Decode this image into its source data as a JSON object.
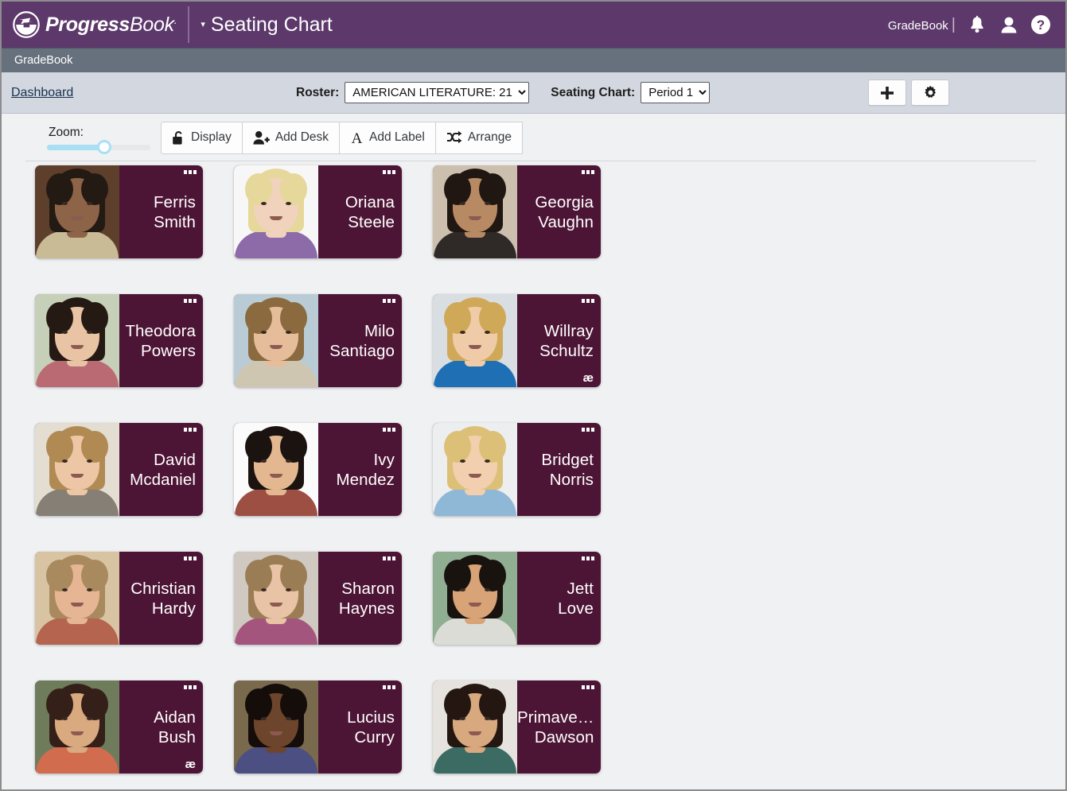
{
  "header": {
    "logo_text_bold": "Progress",
    "logo_text_light": "Book",
    "page_caret": "▾",
    "page_title": "Seating Chart",
    "gradebook_label": "GradeBook",
    "separator": "|",
    "icons": [
      "bell-icon",
      "user-icon",
      "help-icon"
    ]
  },
  "subbar": {
    "label": "GradeBook"
  },
  "controlbar": {
    "dashboard_link": "Dashboard",
    "roster_label": "Roster:",
    "roster_value": "AMERICAN LITERATURE: 21",
    "roster_options": [
      "AMERICAN LITERATURE: 21"
    ],
    "seating_chart_label": "Seating Chart:",
    "seating_chart_value": "Period 1",
    "seating_chart_options": [
      "Period 1"
    ],
    "add_button": "add-icon",
    "settings_button": "gear-icon"
  },
  "toolbar": {
    "zoom_label": "Zoom:",
    "zoom_value": 55,
    "buttons": [
      {
        "label": "Display",
        "icon": "unlock-icon"
      },
      {
        "label": "Add Desk",
        "icon": "add-person-icon"
      },
      {
        "label": "Add Label",
        "icon": "text-a-icon"
      },
      {
        "label": "Arrange",
        "icon": "shuffle-icon"
      }
    ]
  },
  "colors": {
    "header_purple": "#5c386b",
    "subbar_slate": "#67717d",
    "controlbar_bluegray": "#d3d8e0",
    "canvas_bg": "#f0f1f3",
    "card_maroon": "#4d1535",
    "slider_blue": "#a9dff5"
  },
  "seating_chart": {
    "columns": 3,
    "rows": 5,
    "badge_glyph": "æ",
    "menu_icon": "three-dots-icon",
    "students": [
      {
        "first": "Ferris",
        "last": "Smith",
        "badge": false,
        "skin": "#8d6448",
        "hair": "#241a14",
        "bg": "#5d3f2c",
        "shirt": "#c9bb96"
      },
      {
        "first": "Oriana",
        "last": "Steele",
        "badge": false,
        "skin": "#f0d2bd",
        "hair": "#e6d79a",
        "bg": "#f7f7f7",
        "shirt": "#8d6aa8"
      },
      {
        "first": "Georgia",
        "last": "Vaughn",
        "badge": false,
        "skin": "#b88a64",
        "hair": "#201712",
        "bg": "#cdbfae",
        "shirt": "#2f2a28"
      },
      {
        "first": "Theodora",
        "last": "Powers",
        "badge": false,
        "skin": "#e8c3a4",
        "hair": "#241a13",
        "bg": "#c6cfb8",
        "shirt": "#ba6a72"
      },
      {
        "first": "Milo",
        "last": "Santiago",
        "badge": false,
        "skin": "#e6bd9a",
        "hair": "#8a6a3e",
        "bg": "#b9ccd6",
        "shirt": "#cfc6b2"
      },
      {
        "first": "Willray",
        "last": "Schultz",
        "badge": true,
        "skin": "#f0cba8",
        "hair": "#cfa958",
        "bg": "#d9dee2",
        "shirt": "#1f6fb5"
      },
      {
        "first": "David",
        "last": "Mcdaniel",
        "badge": false,
        "skin": "#edc6a6",
        "hair": "#b08a52",
        "bg": "#e3ddd2",
        "shirt": "#857f75"
      },
      {
        "first": "Ivy",
        "last": "Mendez",
        "badge": false,
        "skin": "#e3b78f",
        "hair": "#1b1310",
        "bg": "#fbfbfb",
        "shirt": "#9d4f43"
      },
      {
        "first": "Bridget",
        "last": "Norris",
        "badge": false,
        "skin": "#f2cfae",
        "hair": "#ddc078",
        "bg": "#eceef0",
        "shirt": "#8fb7d6"
      },
      {
        "first": "Christian",
        "last": "Hardy",
        "badge": false,
        "skin": "#e6b694",
        "hair": "#a98a5e",
        "bg": "#d8c4a2",
        "shirt": "#b4644f"
      },
      {
        "first": "Sharon",
        "last": "Haynes",
        "badge": false,
        "skin": "#e9c3a5",
        "hair": "#9b7d55",
        "bg": "#cfc9c2",
        "shirt": "#a4557e"
      },
      {
        "first": "Jett",
        "last": "Love",
        "badge": false,
        "skin": "#d7a377",
        "hair": "#191310",
        "bg": "#8fae92",
        "shirt": "#dcdcd6"
      },
      {
        "first": "Aidan",
        "last": "Bush",
        "badge": true,
        "skin": "#d9a97f",
        "hair": "#342018",
        "bg": "#6f7c5c",
        "shirt": "#d26c4e"
      },
      {
        "first": "Lucius",
        "last": "Curry",
        "badge": false,
        "skin": "#6d452c",
        "hair": "#140d09",
        "bg": "#7a6a4d",
        "shirt": "#4b4f82"
      },
      {
        "first": "Primave…",
        "last": "Dawson",
        "badge": false,
        "skin": "#d8a87f",
        "hair": "#241712",
        "bg": "#e6e3de",
        "shirt": "#3b6b63"
      }
    ]
  }
}
